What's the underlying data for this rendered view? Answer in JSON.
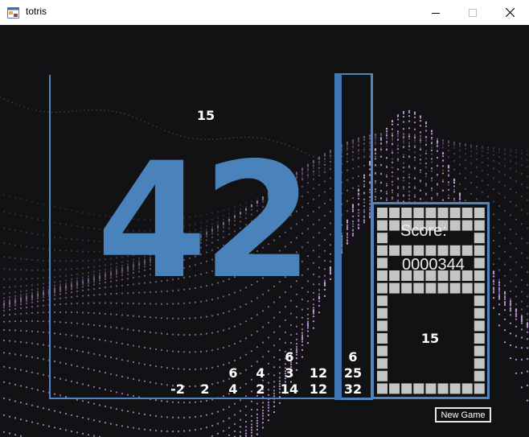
{
  "window": {
    "title": "totris",
    "minimize_icon": "minimize-icon",
    "maximize_icon": "maximize-icon",
    "close_icon": "close-icon"
  },
  "colors": {
    "accent": "#4a82bc",
    "board_border": "#4f86c0",
    "background": "#121214",
    "dots": "#c79ae8",
    "grid_cell": "#c4c4c4"
  },
  "game": {
    "current_piece": "42",
    "next_number_board": "15",
    "cells": [
      {
        "value": "-2",
        "col": 4,
        "row": 0
      },
      {
        "value": "2",
        "col": 5,
        "row": 0
      },
      {
        "value": "4",
        "col": 6,
        "row": 0
      },
      {
        "value": "6",
        "col": 6,
        "row": 1
      },
      {
        "value": "2",
        "col": 7,
        "row": 0
      },
      {
        "value": "4",
        "col": 7,
        "row": 1
      },
      {
        "value": "14",
        "col": 8,
        "row": 0
      },
      {
        "value": "3",
        "col": 8,
        "row": 1
      },
      {
        "value": "6",
        "col": 8,
        "row": 2
      },
      {
        "value": "12",
        "col": 9,
        "row": 0
      },
      {
        "value": "12",
        "col": 9,
        "row": 1
      },
      {
        "value": "32",
        "col": 10,
        "row": 0
      },
      {
        "value": "25",
        "col": 10,
        "row": 1
      },
      {
        "value": "6",
        "col": 10,
        "row": 2
      }
    ]
  },
  "score_panel": {
    "label": "Score:",
    "value": "0000344",
    "next_number": "15"
  },
  "new_game_label": "New Game"
}
